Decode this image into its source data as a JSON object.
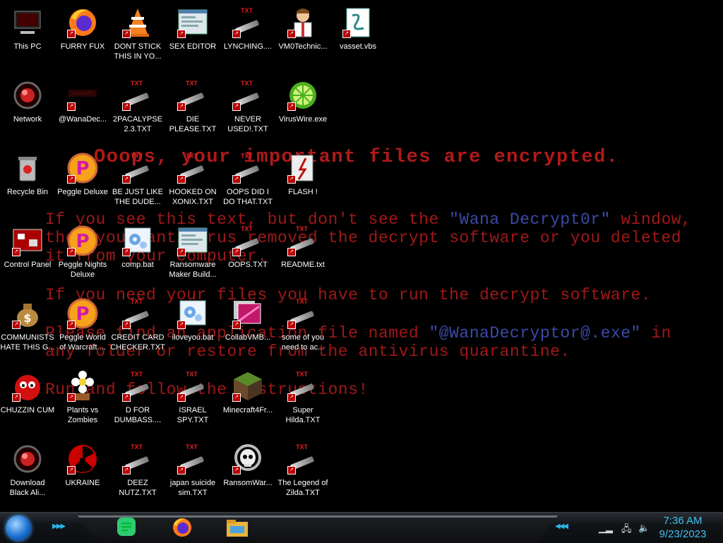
{
  "wallpaper": {
    "title": "Ooops, your important files are encrypted.",
    "p1a": "If you see this text, but don't see the ",
    "p1b": "\"Wana Decrypt0r\"",
    "p1c": " window,",
    "p2": "then your antivirus removed the decrypt software or you deleted",
    "p3": "it from your computer.",
    "p4": "If you need your files you have to run the decrypt software.",
    "p5a": "Please find an application file named ",
    "p5b": "\"@WanaDecryptor@.exe\"",
    "p5c": " in",
    "p6": "any folder or restore from the antivirus quarantine.",
    "p7": "Run and follow the instructions!"
  },
  "icons": [
    {
      "label": "This PC",
      "icon": "computer-icon"
    },
    {
      "label": "FURRY FUX",
      "icon": "firefox-icon"
    },
    {
      "label": "DONT STICK THIS IN YO...",
      "icon": "vlc-cone-icon"
    },
    {
      "label": "SEX EDITOR",
      "icon": "app-window-icon"
    },
    {
      "label": "LYNCHING....",
      "icon": "txt-file-icon"
    },
    {
      "label": "VM0Technic...",
      "icon": "doctor-icon"
    },
    {
      "label": "vasset.vbs",
      "icon": "vbs-script-icon"
    },
    {
      "label": "Network",
      "icon": "network-icon"
    },
    {
      "label": "@WanaDec...",
      "icon": "wanna-decryptor-icon"
    },
    {
      "label": "2PACALYPSE 2.3.TXT",
      "icon": "txt-file-icon"
    },
    {
      "label": "DIE PLEASE.TXT",
      "icon": "txt-file-icon"
    },
    {
      "label": "NEVER USED!.TXT",
      "icon": "txt-file-icon"
    },
    {
      "label": "VirusWire.exe",
      "icon": "lime-icon"
    },
    {
      "label": "Recycle Bin",
      "icon": "recycle-bin-icon"
    },
    {
      "label": "Peggle Deluxe",
      "icon": "peggle-icon"
    },
    {
      "label": "BE JUST LIKE THE DUDE...",
      "icon": "txt-file-icon"
    },
    {
      "label": "HOOKED ON XONIX.TXT",
      "icon": "txt-file-icon"
    },
    {
      "label": "OOPS DID I DO THAT.TXT",
      "icon": "txt-file-icon"
    },
    {
      "label": "FLASH !",
      "icon": "flash-icon"
    },
    {
      "label": "Control Panel",
      "icon": "control-panel-icon"
    },
    {
      "label": "Peggle Nights Deluxe",
      "icon": "peggle-icon"
    },
    {
      "label": "comp.bat",
      "icon": "bat-gear-icon"
    },
    {
      "label": "Ransomware Maker Build...",
      "icon": "app-window-icon"
    },
    {
      "label": "OOPS.TXT",
      "icon": "txt-file-icon"
    },
    {
      "label": "README.txt",
      "icon": "txt-file-icon"
    },
    {
      "label": "COMMUNISTS HATE THIS G...",
      "icon": "money-bag-icon"
    },
    {
      "label": "Peggle World of Warcraft ...",
      "icon": "peggle-icon"
    },
    {
      "label": "CREDIT CARD CHECKER.TXT",
      "icon": "txt-file-icon"
    },
    {
      "label": "iloveyou.bat",
      "icon": "bat-gear-icon"
    },
    {
      "label": "CollabVMB...",
      "icon": "screens-icon"
    },
    {
      "label": "some of you need to ac...",
      "icon": "txt-file-icon"
    },
    {
      "label": "CHUZZIN CUM",
      "icon": "chuzzle-icon"
    },
    {
      "label": "Plants vs Zombies",
      "icon": "flower-icon"
    },
    {
      "label": "D FOR DUMBASS....",
      "icon": "txt-file-icon"
    },
    {
      "label": "ISRAEL SPY.TXT",
      "icon": "txt-file-icon"
    },
    {
      "label": "Minecraft4Fr...",
      "icon": "grass-block-icon"
    },
    {
      "label": "Super Hilda.TXT",
      "icon": "txt-file-icon"
    },
    {
      "label": "Download Black Ali...",
      "icon": "network-icon"
    },
    {
      "label": "UKRAINE",
      "icon": "radiation-icon"
    },
    {
      "label": "DEEZ NUTZ.TXT",
      "icon": "txt-file-icon"
    },
    {
      "label": "japan suicide sim.TXT",
      "icon": "txt-file-icon"
    },
    {
      "label": "RansomWar...",
      "icon": "skull-icon"
    },
    {
      "label": "The Legend of Zilda.TXT",
      "icon": "txt-file-icon"
    }
  ],
  "taskbar": {
    "apps": [
      "notes-app-icon",
      "firefox-icon",
      "file-explorer-icon"
    ],
    "time": "7:36 AM",
    "date": "9/23/2023"
  },
  "colors": {
    "wallpaper_text": "#a01818",
    "wallpaper_highlight": "#3a4aa8",
    "clock": "#3fc3f0"
  }
}
